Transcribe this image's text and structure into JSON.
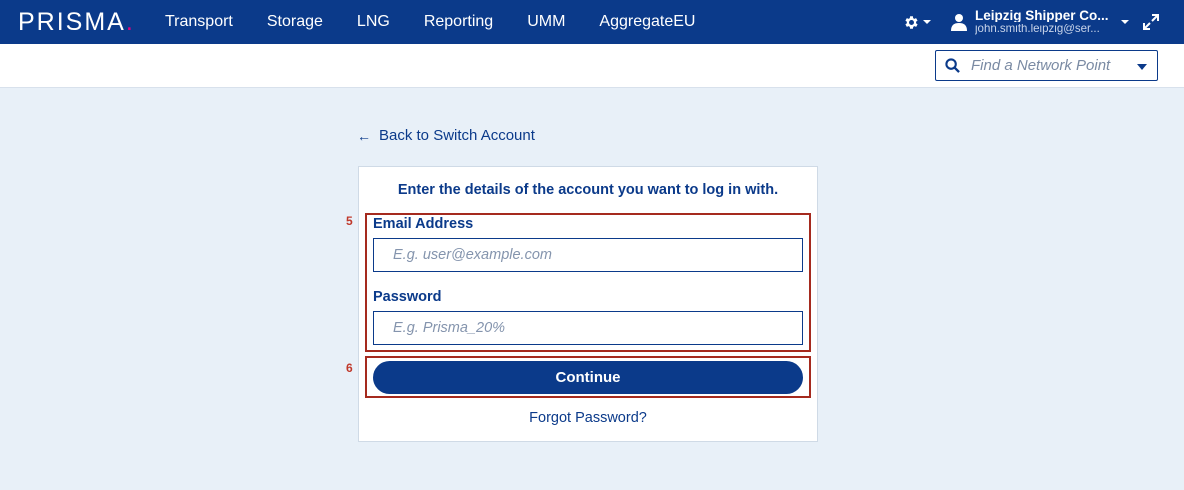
{
  "header": {
    "logo_text": "PRISMA",
    "logo_dot": ".",
    "nav": [
      "Transport",
      "Storage",
      "LNG",
      "Reporting",
      "UMM",
      "AggregateEU"
    ],
    "user_name": "Leipzig Shipper Co...",
    "user_email": "john.smith.leipzig@ser...",
    "brand_color": "#0b3a8a",
    "accent_color": "#e6007e"
  },
  "subbar": {
    "network_point_placeholder": "Find a Network Point"
  },
  "back_link": {
    "arrow": "←",
    "label": "Back to Switch Account"
  },
  "login_card": {
    "title": "Enter the details of the account you want to log in with.",
    "email_label": "Email Address",
    "email_placeholder": "E.g. user@example.com",
    "email_value": "",
    "password_label": "Password",
    "password_placeholder": "E.g. Prisma_20%",
    "password_value": "",
    "continue_label": "Continue",
    "forgot_label": "Forgot Password?"
  },
  "annotations": {
    "step_5": "5",
    "step_6": "6",
    "highlight_color": "#a52a1e"
  }
}
